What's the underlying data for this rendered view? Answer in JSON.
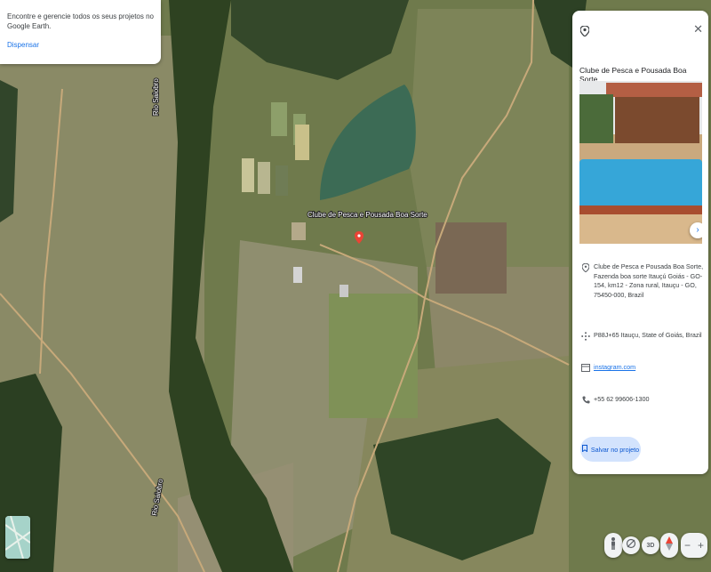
{
  "toast": {
    "message": "Encontre e gerencie todos os seus projetos no Google Earth.",
    "dismiss_label": "Dispensar"
  },
  "map": {
    "labels": {
      "place": "Clube de Pesca e Pousada Boa Sorte",
      "river_top": "Rio Saiobro",
      "river_bottom": "Rio Saiobro"
    }
  },
  "panel": {
    "title": "Clube de Pesca e Pousada Boa Sorte",
    "address": "Clube de Pesca e Pousada Boa Sorte, Fazenda boa sorte Itauçú Goiás - GO-154, km12 - Zona rural, Itauçu - GO, 75450-000, Brazil",
    "plus_code": "P88J+65 Itauçu, State of Goiás, Brazil",
    "website": "instagram.com",
    "phone": "+55 62 99606-1300",
    "save_label": "Salvar no projeto"
  },
  "controls": {
    "view_3d": "3D",
    "zoom_out": "−",
    "zoom_in": "+"
  },
  "colors": {
    "accent": "#1a73e8",
    "marker": "#ea4335"
  }
}
